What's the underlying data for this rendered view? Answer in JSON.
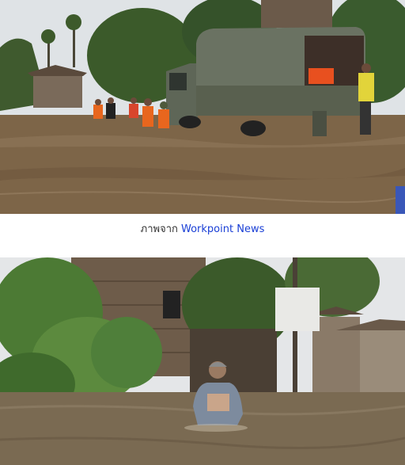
{
  "photo_top": {
    "icon": "flood-scene-rescue-truck",
    "colors": {
      "water": "#7d6548",
      "sky": "#dfe3e6",
      "truck": "#5e6657"
    }
  },
  "caption": {
    "prefix": "ภาพจาก",
    "source_link": "Workpoint News",
    "link_color": "#1a3fd6"
  },
  "photo_bottom": {
    "icon": "flood-scene-woman-wading",
    "colors": {
      "water": "#7a6a52",
      "sky": "#e4e6e8",
      "house": "#6e5c4a"
    }
  }
}
